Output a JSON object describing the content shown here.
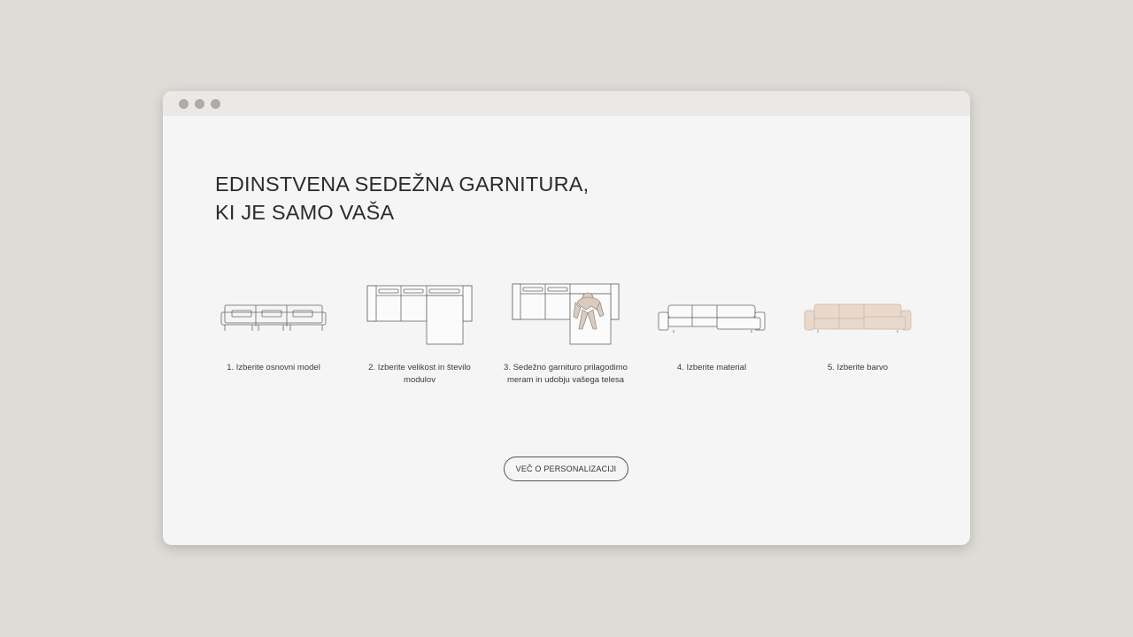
{
  "window": {
    "controls": [
      "window-dot",
      "window-dot",
      "window-dot"
    ]
  },
  "hero": {
    "title_line1": "EDINSTVENA SEDEŽNA GARNITURA,",
    "title_line2": "KI JE SAMO VAŠA"
  },
  "steps": [
    {
      "label": "1. Izberite osnovni model",
      "icon": "sofa-outline-icon"
    },
    {
      "label": "2. Izberite velikost in število modulov",
      "icon": "modular-sofa-topview-icon"
    },
    {
      "label": "3. Sedežno garnituro prilagodimo meram in udobju vašega telesa",
      "icon": "sofa-with-person-icon"
    },
    {
      "label": "4. Izberite material",
      "icon": "corner-sofa-outline-icon"
    },
    {
      "label": "5. Izberite barvo",
      "icon": "colored-sofa-icon"
    }
  ],
  "cta": {
    "label": "VEČ O PERSONALIZACIJI"
  },
  "colors": {
    "page_background": "#dedcd7",
    "window_background": "#f5f5f5",
    "titlebar": "#eae9e7",
    "window_dot": "#aeaca6",
    "sofa_fill": "#e8d9cc",
    "line": "#555555"
  }
}
